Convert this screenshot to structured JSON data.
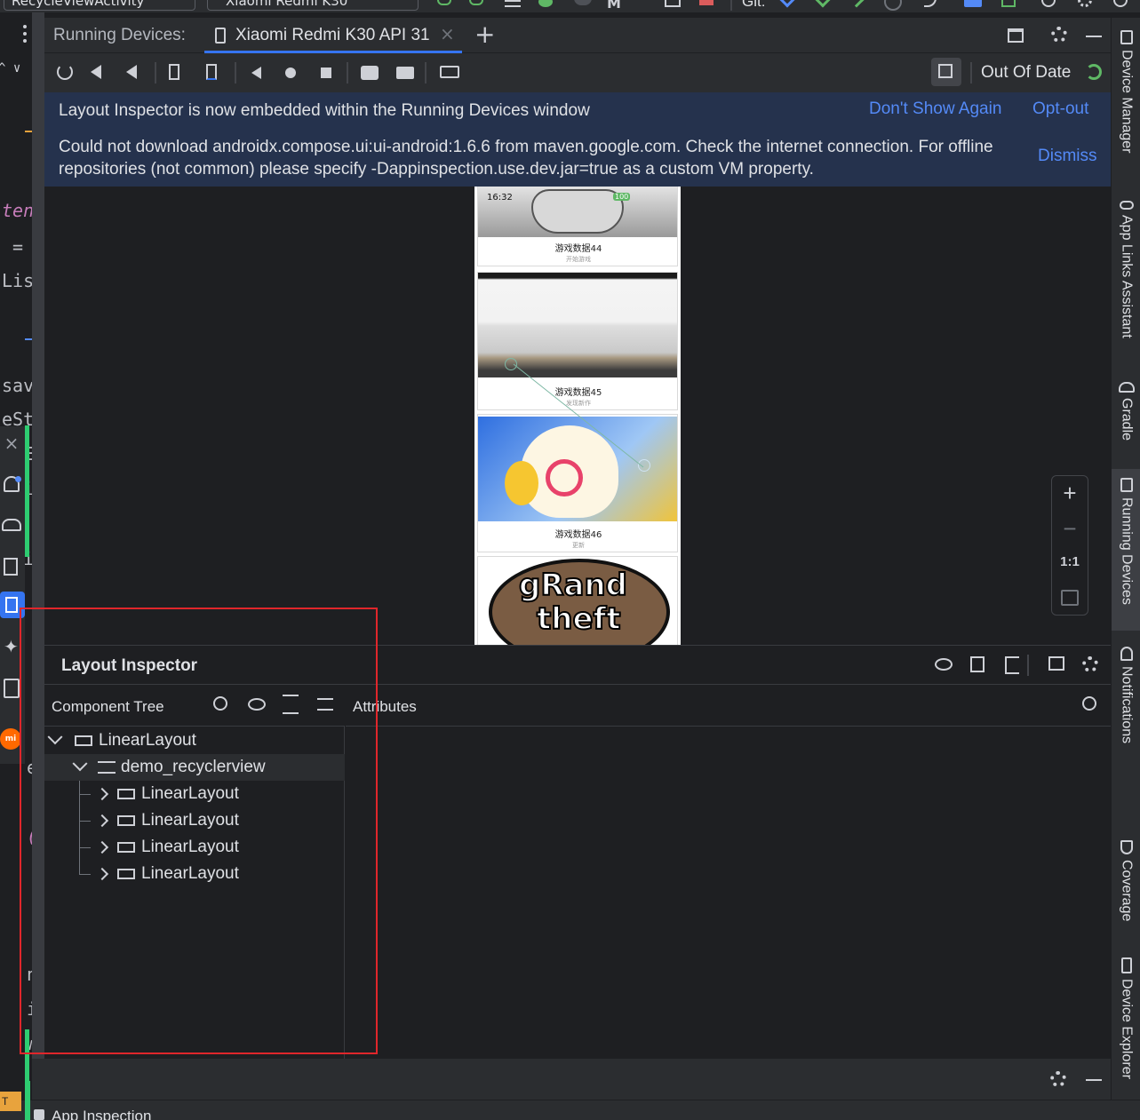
{
  "toolbar": {
    "run_config": "RecycleViewActivity",
    "device_selector": "Xiaomi Redmi K30",
    "git_label": "Git:"
  },
  "editor": {
    "fragments": [
      "tend",
      "= '",
      "List",
      "save",
      "eSta",
      "Ed",
      "it",
      "ir",
      "(r",
      "er",
      "(r",
      "n",
      "ir",
      "Wa"
    ]
  },
  "running_devices": {
    "title": "Running Devices:",
    "tab_label": "Xiaomi Redmi K30 API 31",
    "out_of_date": "Out Of Date"
  },
  "banner": {
    "message1": "Layout Inspector is now embedded within the Running Devices window",
    "dont_show_again": "Don't Show Again",
    "opt_out": "Opt-out",
    "message2_line1": "Could not download androidx.compose.ui:ui-android:1.6.6 from maven.google.com. Check the internet connection. For offline",
    "message2_line2": "repositories (not common) please specify -Dappinspection.use.dev.jar=true as a custom VM property.",
    "dismiss": "Dismiss"
  },
  "device": {
    "status_time": "16:32",
    "battery": "100",
    "cards": [
      {
        "title": "游戏数据44",
        "subtitle": "开始游戏"
      },
      {
        "title": "游戏数据45",
        "subtitle": "发现新作"
      },
      {
        "title": "游戏数据46",
        "subtitle": "更新"
      },
      {
        "title": "",
        "subtitle": ""
      }
    ],
    "gta_line1": "gRand",
    "gta_line2": "theft"
  },
  "zoom": {
    "zoom_in": "+",
    "zoom_out": "−",
    "actual_size": "1:1"
  },
  "layout_inspector": {
    "title": "Layout Inspector",
    "component_tree_label": "Component Tree",
    "attributes_label": "Attributes",
    "tree": [
      {
        "label": "LinearLayout",
        "icon": "linear-layout-icon"
      },
      {
        "label": "demo_recyclerview",
        "icon": "recyclerview-icon"
      },
      {
        "label": "LinearLayout",
        "icon": "linear-layout-icon"
      },
      {
        "label": "LinearLayout",
        "icon": "linear-layout-icon"
      },
      {
        "label": "LinearLayout",
        "icon": "linear-layout-icon"
      },
      {
        "label": "LinearLayout",
        "icon": "linear-layout-icon"
      }
    ]
  },
  "right_strip": {
    "tabs": [
      "Device Manager",
      "App Links Assistant",
      "Gradle",
      "Running Devices",
      "Notifications",
      "Coverage",
      "Device Explorer"
    ]
  },
  "status": {
    "app_inspection": "App Inspection",
    "left_badge": "T"
  },
  "colors": {
    "accent": "#548af7",
    "highlight": "#e0262b",
    "banner_bg": "#25324d",
    "panel_bg": "#2b2d30"
  }
}
